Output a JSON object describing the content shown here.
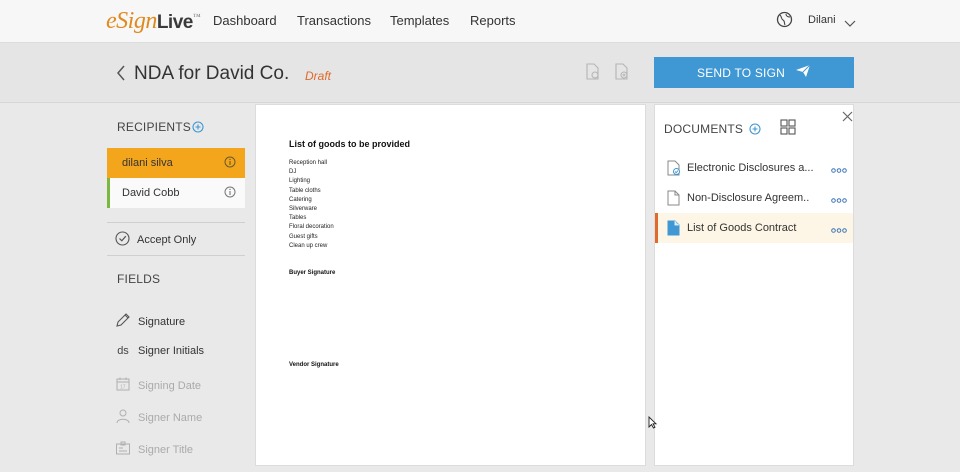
{
  "app": {
    "logo_e": "e",
    "logo_sign": "Sign",
    "logo_live": "Live",
    "logo_tm": "™"
  },
  "nav": {
    "items": [
      {
        "label": "Dashboard"
      },
      {
        "label": "Transactions"
      },
      {
        "label": "Templates"
      },
      {
        "label": "Reports"
      }
    ],
    "user": "Dilani"
  },
  "header": {
    "title": "NDA for David Co.",
    "status": "Draft",
    "send_label": "SEND TO SIGN"
  },
  "recipients": {
    "title": "RECIPIENTS",
    "items": [
      {
        "name": "dilani silva",
        "active": true
      },
      {
        "name": "David Cobb",
        "active": false
      }
    ],
    "accept_only": "Accept Only"
  },
  "fields": {
    "title": "FIELDS",
    "items": [
      {
        "label": "Signature",
        "enabled": true
      },
      {
        "label": "Signer Initials",
        "enabled": true,
        "abbr": "ds"
      },
      {
        "label": "Signing Date",
        "enabled": false
      },
      {
        "label": "Signer Name",
        "enabled": false
      },
      {
        "label": "Signer Title",
        "enabled": false
      }
    ]
  },
  "document": {
    "heading": "List of goods to be provided",
    "items": [
      "Reception hall",
      "DJ",
      "Lighting",
      "Table cloths",
      "Catering",
      "Silverware",
      "Tables",
      "Floral decoration",
      "Guest gifts",
      "Clean up crew"
    ],
    "buyer_signature": "Buyer Signature",
    "vendor_signature": "Vendor Signature"
  },
  "documents": {
    "title": "DOCUMENTS",
    "items": [
      {
        "name": "Electronic Disclosures a...",
        "active": false
      },
      {
        "name": "Non-Disclosure Agreem..",
        "active": false
      },
      {
        "name": "List of Goods Contract",
        "active": true
      }
    ]
  },
  "colors": {
    "accent_blue": "#3f97d3",
    "active_orange": "#f3a51c",
    "draft_orange": "#e06a2b",
    "recipient_green": "#7ab840"
  }
}
